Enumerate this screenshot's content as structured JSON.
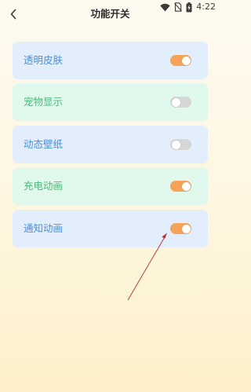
{
  "status_bar": {
    "time": "4:22",
    "icons": [
      "wifi-icon",
      "no-sim-icon",
      "battery-icon"
    ]
  },
  "header": {
    "title": "功能开关",
    "back_icon": "chevron-left-icon"
  },
  "settings": [
    {
      "label": "透明皮肤",
      "enabled": true,
      "theme": "blue"
    },
    {
      "label": "宠物显示",
      "enabled": false,
      "theme": "green"
    },
    {
      "label": "动态壁纸",
      "enabled": false,
      "theme": "blue"
    },
    {
      "label": "充电动画",
      "enabled": true,
      "theme": "green"
    },
    {
      "label": "通知动画",
      "enabled": true,
      "theme": "blue"
    }
  ],
  "colors": {
    "toggle_on": "#f5a359",
    "toggle_off": "#d6d6d6",
    "blue_card": "#e2eefc",
    "green_card": "#e1f8ec",
    "blue_text": "#4a8fd6",
    "green_text": "#4cb97a",
    "annotation_arrow": "#b03030"
  }
}
